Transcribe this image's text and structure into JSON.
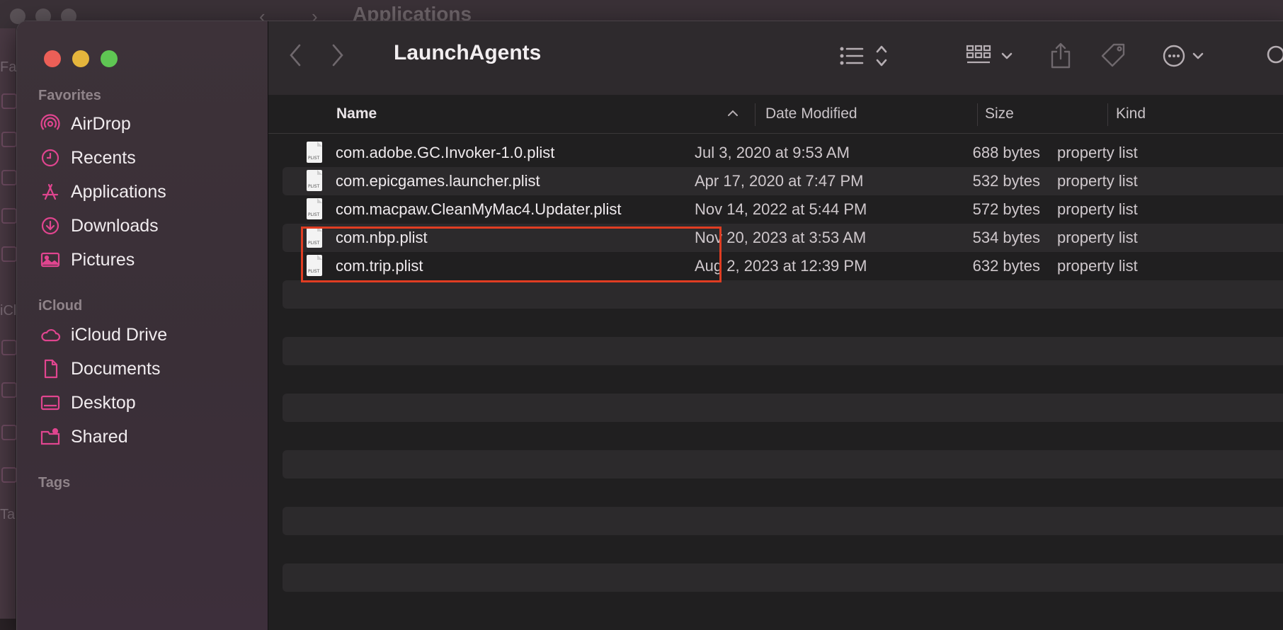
{
  "background_window": {
    "title": "Applications",
    "sidebar_fragments": [
      "Fa",
      "iCl",
      "Ta"
    ]
  },
  "window": {
    "title": "LaunchAgents"
  },
  "sidebar": {
    "favorites_label": "Favorites",
    "favorites": [
      {
        "label": "AirDrop",
        "icon": "airdrop-icon"
      },
      {
        "label": "Recents",
        "icon": "clock-icon"
      },
      {
        "label": "Applications",
        "icon": "applications-icon"
      },
      {
        "label": "Downloads",
        "icon": "download-icon"
      },
      {
        "label": "Pictures",
        "icon": "photo-icon"
      }
    ],
    "icloud_label": "iCloud",
    "icloud": [
      {
        "label": "iCloud Drive",
        "icon": "cloud-icon"
      },
      {
        "label": "Documents",
        "icon": "document-icon"
      },
      {
        "label": "Desktop",
        "icon": "desktop-icon"
      },
      {
        "label": "Shared",
        "icon": "shared-folder-icon"
      }
    ],
    "tags_label": "Tags",
    "accent_color": "#e0458f"
  },
  "columns": {
    "name": "Name",
    "date": "Date Modified",
    "size": "Size",
    "kind": "Kind",
    "sort_indicator": "^"
  },
  "files": [
    {
      "name": "com.adobe.GC.Invoker-1.0.plist",
      "date": "Jul 3, 2020 at 9:53 AM",
      "size": "688 bytes",
      "kind": "property list"
    },
    {
      "name": "com.epicgames.launcher.plist",
      "date": "Apr 17, 2020 at 7:47 PM",
      "size": "532 bytes",
      "kind": "property list"
    },
    {
      "name": "com.macpaw.CleanMyMac4.Updater.plist",
      "date": "Nov 14, 2022 at 5:44 PM",
      "size": "572 bytes",
      "kind": "property list"
    },
    {
      "name": "com.nbp.plist",
      "date": "Nov 20, 2023 at 3:53 AM",
      "size": "534 bytes",
      "kind": "property list"
    },
    {
      "name": "com.trip.plist",
      "date": "Aug 2, 2023 at 12:39 PM",
      "size": "632 bytes",
      "kind": "property list"
    }
  ],
  "file_icon_tag": "PLIST",
  "highlight_color": "#e03d22"
}
